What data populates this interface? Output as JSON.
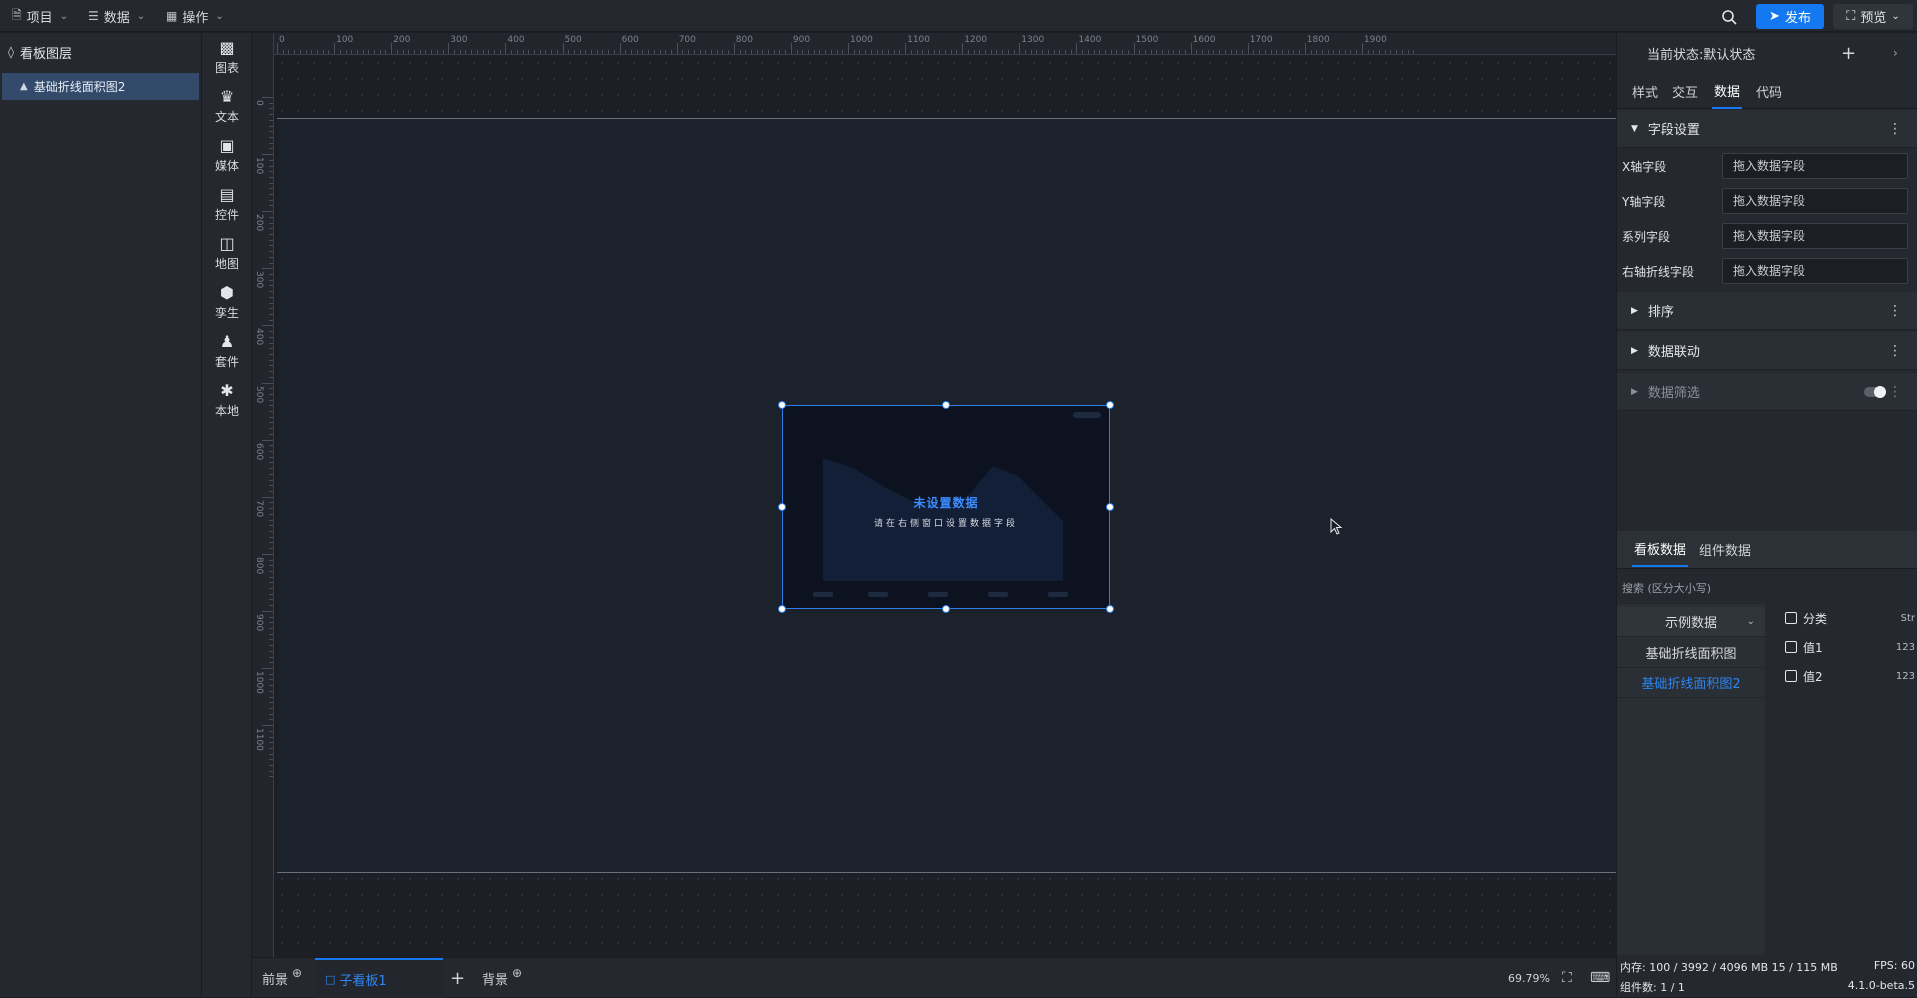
{
  "topbar": {
    "menus": [
      {
        "label": "项目",
        "icon": "file-icon"
      },
      {
        "label": "数据",
        "icon": "database-icon"
      },
      {
        "label": "操作",
        "icon": "grid-icon"
      }
    ],
    "publish_label": "发布",
    "preview_label": "预览"
  },
  "layers": {
    "title": "看板图层",
    "items": [
      {
        "label": "基础折线面积图2"
      }
    ]
  },
  "components": [
    {
      "label": "图表",
      "icon": "bar-chart-icon"
    },
    {
      "label": "文本",
      "icon": "crown-icon"
    },
    {
      "label": "媒体",
      "icon": "camera-icon"
    },
    {
      "label": "控件",
      "icon": "control-icon"
    },
    {
      "label": "地图",
      "icon": "map-icon"
    },
    {
      "label": "孪生",
      "icon": "cube-icon"
    },
    {
      "label": "套件",
      "icon": "shirt-icon"
    },
    {
      "label": "本地",
      "icon": "puzzle-icon"
    }
  ],
  "canvas": {
    "ruler_top": [
      "0",
      "100",
      "200",
      "300",
      "400",
      "500",
      "600",
      "700",
      "800",
      "900",
      "1000",
      "1100",
      "1200",
      "1300",
      "1400",
      "1500",
      "1600",
      "1700",
      "1800",
      "1900"
    ],
    "ruler_left": [
      "0",
      "100",
      "200",
      "300",
      "400",
      "500",
      "600",
      "700",
      "800",
      "900",
      "1000",
      "1100"
    ],
    "chart_title": "未设置数据",
    "chart_subtitle": "请在右侧窗口设置数据字段"
  },
  "bottombar": {
    "tabs": [
      {
        "label": "前景"
      },
      {
        "label": "子看板1"
      },
      {
        "label": "背景"
      }
    ],
    "zoom": "69.79%"
  },
  "right_panel": {
    "state_label": "当前状态: ",
    "state_value": "默认状态",
    "tabs": [
      "样式",
      "交互",
      "数据",
      "代码"
    ],
    "active_tab": "数据",
    "field_settings": {
      "title": "字段设置",
      "fields": [
        {
          "label": "X轴字段",
          "placeholder": "拖入数据字段"
        },
        {
          "label": "Y轴字段",
          "placeholder": "拖入数据字段"
        },
        {
          "label": "系列字段",
          "placeholder": "拖入数据字段"
        },
        {
          "label": "右轴折线字段",
          "placeholder": "拖入数据字段"
        }
      ]
    },
    "sections": [
      "排序",
      "数据联动",
      "数据筛选"
    ],
    "data_tabs": [
      "看板数据",
      "组件数据"
    ],
    "search_placeholder": "搜索 (区分大小写)",
    "datasets": {
      "dropdown": "示例数据",
      "items": [
        "基础折线面积图",
        "基础折线面积图2"
      ],
      "selected": "基础折线面积图2"
    },
    "data_fields": [
      {
        "name": "分类",
        "type": "Str"
      },
      {
        "name": "值1",
        "type": "123"
      },
      {
        "name": "值2",
        "type": "123"
      }
    ]
  },
  "status": {
    "memory_label": "内存: ",
    "memory_value": "100 / 3992 / 4096 MB 15 / 115 MB",
    "fps": "FPS:  60",
    "components_label": "组件数: 1 / 1",
    "version": "4.1.0-beta.5"
  },
  "colors": {
    "accent": "#1478f0",
    "selected_layer": "#334a6b",
    "chart_border": "#2d7ee8"
  }
}
